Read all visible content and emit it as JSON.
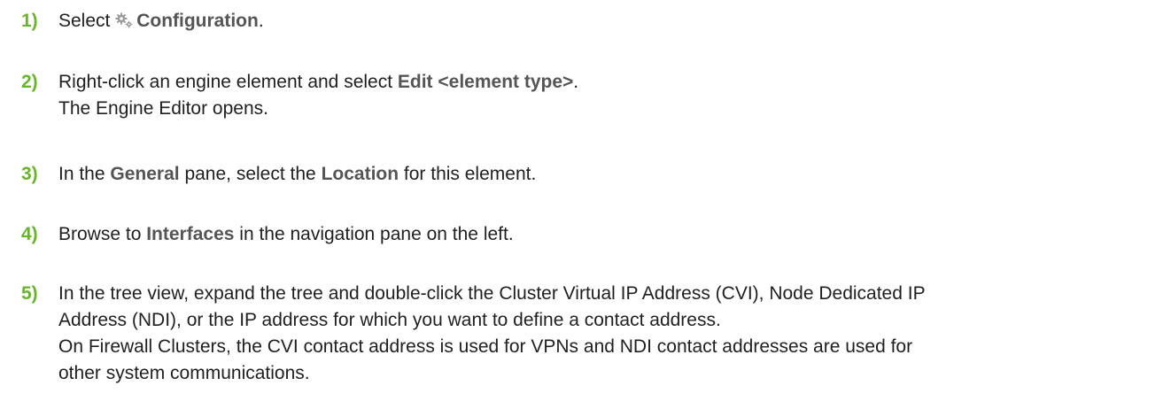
{
  "steps": [
    {
      "num": "1)",
      "before": "Select ",
      "ui": "Configuration",
      "after": "."
    },
    {
      "num": "2)",
      "before": "Right-click an engine element and select ",
      "ui": "Edit <element type>",
      "after": ".",
      "sub": "The Engine Editor opens."
    },
    {
      "num": "3)",
      "before": "In the ",
      "ui1": "General",
      "middle": " pane, select the ",
      "ui2": "Location",
      "after": " for this element."
    },
    {
      "num": "4)",
      "before": "Browse to ",
      "ui": "Interfaces",
      "after": " in the navigation pane on the left."
    },
    {
      "num": "5)",
      "line1": "In the tree view, expand the tree and double-click the Cluster Virtual IP Address (CVI), Node Dedicated IP",
      "line2": "Address (NDI), or the IP address for which you want to define a contact address.",
      "sub1": "On Firewall Clusters, the CVI contact address is used for VPNs and NDI contact addresses are used for",
      "sub2": "other system communications."
    }
  ],
  "colors": {
    "step_number": "#6ab42d",
    "ui_term": "#555555",
    "body_text": "#1f1f1f"
  },
  "icons": {
    "configuration": "gear-icon"
  }
}
